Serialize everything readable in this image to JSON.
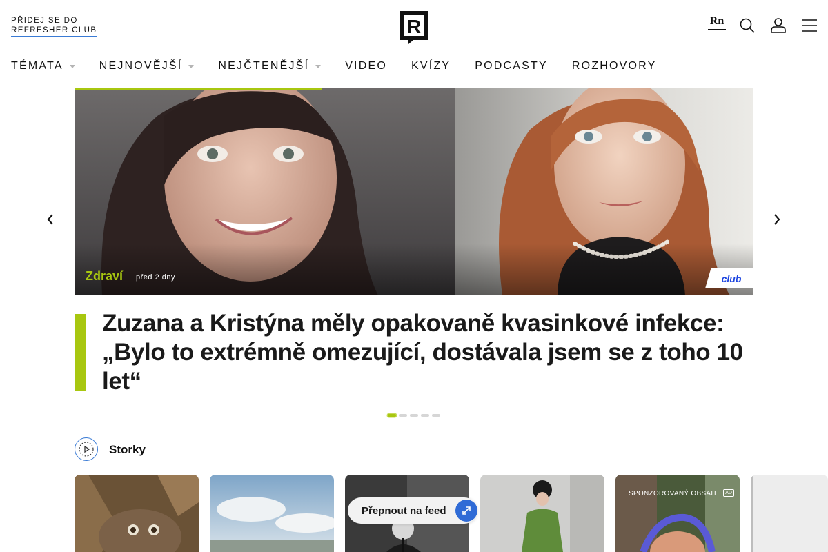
{
  "header": {
    "club_line1": "PŘIDEJ SE DO",
    "club_line2": "REFRESHER CLUB",
    "logo_letter": "R",
    "rn_label": "Rn",
    "icons": [
      "search-icon",
      "user-icon",
      "menu-icon"
    ]
  },
  "nav": {
    "items": [
      {
        "label": "TÉMATA",
        "dropdown": true
      },
      {
        "label": "NEJNOVĚJŠÍ",
        "dropdown": true
      },
      {
        "label": "NEJČTENĚJŠÍ",
        "dropdown": true
      },
      {
        "label": "VIDEO",
        "dropdown": false
      },
      {
        "label": "KVÍZY",
        "dropdown": false
      },
      {
        "label": "PODCASTY",
        "dropdown": false
      },
      {
        "label": "ROZHOVORY",
        "dropdown": false
      }
    ]
  },
  "hero": {
    "category": "Zdraví",
    "time": "před 2 dny",
    "badge": "club",
    "headline": "Zuzana a Kristýna měly opakovaně kvasinkové infekce: „Bylo to extrémně omezující, dostávala jsem se z toho 10 let“",
    "slide_count": 5,
    "active_slide": 1
  },
  "stories": {
    "title": "Storky",
    "feed_button": "Přepnout na feed",
    "sponsored_label": "SPONZOROVANÝ OBSAH",
    "ad_label": "AD"
  },
  "colors": {
    "accent_green": "#a8c710",
    "accent_blue": "#2f6bd6",
    "club_blue": "#1e46e0"
  }
}
